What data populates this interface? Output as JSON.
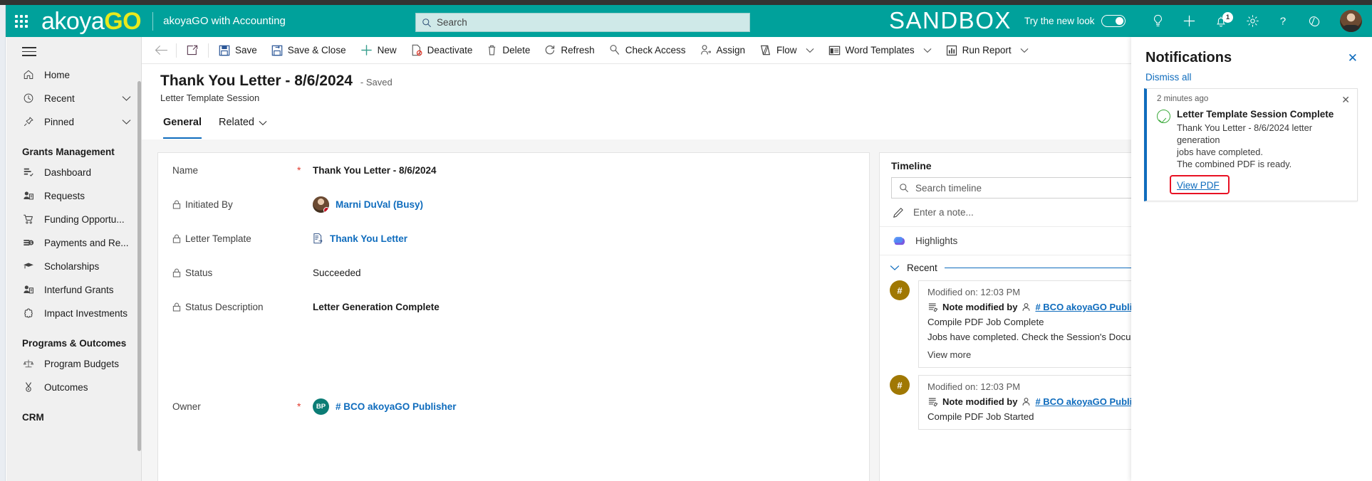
{
  "header": {
    "waffle_icon": "waffle-grid-icon",
    "brand_first": "akoya",
    "brand_second": "GO",
    "app_name": "akoyaGO with Accounting",
    "search_placeholder": "Search",
    "search_value": "",
    "environment_label": "SANDBOX",
    "new_look_label": "Try the new look",
    "new_look_on": "on",
    "notification_count": "1",
    "icons": [
      "lightbulb-icon",
      "plus-icon",
      "bell-icon",
      "gear-icon",
      "help-icon",
      "diagnostics-icon",
      "avatar"
    ],
    "accent_color": "#00a19b",
    "brand_go_color": "#e8ea1d"
  },
  "sidebar": {
    "menu_icon": "hamburger-icon",
    "items": [
      {
        "label": "Home",
        "icon": "home-icon",
        "chevron": false
      },
      {
        "label": "Recent",
        "icon": "clock-icon",
        "chevron": true
      },
      {
        "label": "Pinned",
        "icon": "pin-icon",
        "chevron": true
      }
    ],
    "groups": [
      {
        "title": "Grants Management",
        "items": [
          {
            "label": "Dashboard",
            "icon": "dashboard-icon"
          },
          {
            "label": "Requests",
            "icon": "requests-icon"
          },
          {
            "label": "Funding Opportu...",
            "icon": "cart-icon"
          },
          {
            "label": "Payments and Re...",
            "icon": "payments-icon"
          },
          {
            "label": "Scholarships",
            "icon": "graduation-cap-icon"
          },
          {
            "label": "Interfund Grants",
            "icon": "interfund-icon"
          },
          {
            "label": "Impact Investments",
            "icon": "impact-icon"
          }
        ]
      },
      {
        "title": "Programs & Outcomes",
        "items": [
          {
            "label": "Program Budgets",
            "icon": "scales-icon"
          },
          {
            "label": "Outcomes",
            "icon": "medal-icon"
          }
        ]
      },
      {
        "title": "CRM",
        "items": []
      }
    ]
  },
  "commandbar": {
    "back_icon": "back-arrow-icon",
    "popout_icon": "open-in-new-window-icon",
    "items": [
      {
        "label": "Save",
        "icon": "save-icon",
        "caret": false
      },
      {
        "label": "Save & Close",
        "icon": "save-close-icon",
        "caret": false
      },
      {
        "label": "New",
        "icon": "plus-icon",
        "caret": false
      },
      {
        "label": "Deactivate",
        "icon": "deactivate-icon",
        "caret": false
      },
      {
        "label": "Delete",
        "icon": "trash-icon",
        "caret": false
      },
      {
        "label": "Refresh",
        "icon": "refresh-icon",
        "caret": false
      },
      {
        "label": "Check Access",
        "icon": "check-access-icon",
        "caret": false
      },
      {
        "label": "Assign",
        "icon": "assign-icon",
        "caret": false
      },
      {
        "label": "Flow",
        "icon": "flow-icon",
        "caret": true
      },
      {
        "label": "Word Templates",
        "icon": "word-templates-icon",
        "caret": true
      },
      {
        "label": "Run Report",
        "icon": "run-report-icon",
        "caret": true
      }
    ]
  },
  "record": {
    "title": "Thank You Letter - 8/6/2024",
    "saved_state": "- Saved",
    "entity": "Letter Template Session",
    "tabs": [
      {
        "label": "General",
        "active": true,
        "caret": false
      },
      {
        "label": "Related",
        "active": false,
        "caret": true
      }
    ]
  },
  "form": {
    "fields": [
      {
        "label": "Name",
        "locked": false,
        "required": true,
        "value": "Thank You Letter - 8/6/2024",
        "kind": "text"
      },
      {
        "label": "Initiated By",
        "locked": true,
        "required": false,
        "value": "Marni DuVal (Busy)",
        "kind": "person"
      },
      {
        "label": "Letter Template",
        "locked": true,
        "required": false,
        "value": "Thank You Letter",
        "kind": "link",
        "icon": "document-link-icon"
      },
      {
        "label": "Status",
        "locked": true,
        "required": false,
        "value": "Succeeded",
        "kind": "plain"
      },
      {
        "label": "Status Description",
        "locked": true,
        "required": false,
        "value": "Letter Generation Complete",
        "kind": "text"
      },
      {
        "label": "Owner",
        "locked": false,
        "required": true,
        "value": "# BCO akoyaGO Publisher",
        "kind": "owner",
        "initials": "BP"
      }
    ]
  },
  "timeline": {
    "title": "Timeline",
    "search_placeholder": "Search timeline",
    "search_icon": "search-icon",
    "note_placeholder": "Enter a note...",
    "note_icon": "pencil-icon",
    "highlights_label": "Highlights",
    "highlights_icon": "copilot-icon",
    "recent_label": "Recent",
    "recent_chevron_icon": "chevron-down-icon",
    "entries": [
      {
        "avatar_text": "#",
        "time": "Modified on: 12:03 PM",
        "by_prefix": "Note modified by",
        "by_link": "# BCO akoyaGO Publisher",
        "note_icon": "note-icon",
        "person_icon": "person-icon",
        "line1": "Compile PDF Job Complete",
        "line2": "Jobs have completed. Check the Session's Documents for the full PDF file",
        "view_more": "View more"
      },
      {
        "avatar_text": "#",
        "time": "Modified on: 12:03 PM",
        "by_prefix": "Note modified by",
        "by_link": "# BCO akoyaGO Publisher",
        "note_icon": "note-icon",
        "person_icon": "person-icon",
        "line1": "Compile PDF Job Started",
        "line2": "",
        "view_more": ""
      }
    ]
  },
  "notifications": {
    "title": "Notifications",
    "close_icon": "close-icon",
    "dismiss_all": "Dismiss all",
    "card": {
      "time": "2 minutes ago",
      "close_icon": "close-icon",
      "status_icon": "success-check-icon",
      "heading": "Letter Template Session Complete",
      "body_line1": "Thank You Letter - 8/6/2024 letter generation",
      "body_line2": "jobs have completed.",
      "body_line3": "The combined PDF is ready.",
      "action_label": "View PDF",
      "highlight_color": "#e81123",
      "accent_color": "#0f6cbd"
    }
  }
}
